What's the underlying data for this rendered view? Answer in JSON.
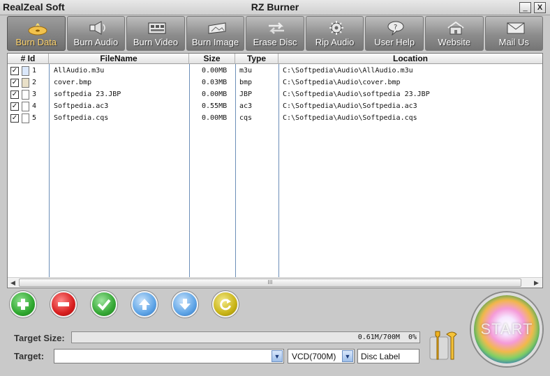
{
  "window": {
    "app_name": "RealZeal Soft",
    "title": "RZ Burner",
    "minimize_glyph": "_",
    "close_glyph": "X"
  },
  "toolbar": [
    {
      "label": "Burn Data",
      "icon": "disc-flame-icon",
      "active": true
    },
    {
      "label": "Burn Audio",
      "icon": "speaker-icon"
    },
    {
      "label": "Burn Video",
      "icon": "film-icon"
    },
    {
      "label": "Burn Image",
      "icon": "disc-image-icon"
    },
    {
      "label": "Erase Disc",
      "icon": "erase-arrows-icon"
    },
    {
      "label": "Rip Audio",
      "icon": "gear-rip-icon"
    },
    {
      "label": "User Help",
      "icon": "help-bubble-icon"
    },
    {
      "label": "Website",
      "icon": "house-icon"
    },
    {
      "label": "Mail Us",
      "icon": "envelope-icon"
    }
  ],
  "list": {
    "columns": [
      "# Id",
      "FileName",
      "Size",
      "Type",
      "Location"
    ],
    "rows": [
      {
        "id": "1",
        "name": "AllAudio.m3u",
        "size": "0.00MB",
        "type": "m3u",
        "location": "C:\\Softpedia\\Audio\\AllAudio.m3u",
        "checked": true
      },
      {
        "id": "2",
        "name": "cover.bmp",
        "size": "0.03MB",
        "type": "bmp",
        "location": "C:\\Softpedia\\Audio\\cover.bmp",
        "checked": true
      },
      {
        "id": "3",
        "name": "softpedia 23.JBP",
        "size": "0.00MB",
        "type": "JBP",
        "location": "C:\\Softpedia\\Audio\\softpedia 23.JBP",
        "checked": true
      },
      {
        "id": "4",
        "name": "Softpedia.ac3",
        "size": "0.55MB",
        "type": "ac3",
        "location": "C:\\Softpedia\\Audio\\Softpedia.ac3",
        "checked": true
      },
      {
        "id": "5",
        "name": "Softpedia.cqs",
        "size": "0.00MB",
        "type": "cqs",
        "location": "C:\\Softpedia\\Audio\\Softpedia.cqs",
        "checked": true
      }
    ],
    "scroll_grip": "III"
  },
  "actions": [
    {
      "name": "add-button",
      "icon": "plus-icon",
      "color": "#2fa82f"
    },
    {
      "name": "remove-button",
      "icon": "minus-icon",
      "color": "#d81e1e"
    },
    {
      "name": "check-button",
      "icon": "checkmark-icon",
      "color": "#35a835"
    },
    {
      "name": "move-up-button",
      "icon": "arrow-up-icon",
      "color": "#5ea4e6"
    },
    {
      "name": "move-down-button",
      "icon": "arrow-down-icon",
      "color": "#5ea4e6"
    },
    {
      "name": "refresh-button",
      "icon": "refresh-icon",
      "color": "#c9b416"
    }
  ],
  "bottom": {
    "target_size_label": "Target Size:",
    "progress_text": "0.61M/700M",
    "progress_percent": "0%",
    "progress_fraction": 0.0,
    "target_label": "Target:",
    "target_value": "",
    "disc_type": "VCD(700M)",
    "disc_label": "Disc Label"
  },
  "start": {
    "label": "START"
  }
}
